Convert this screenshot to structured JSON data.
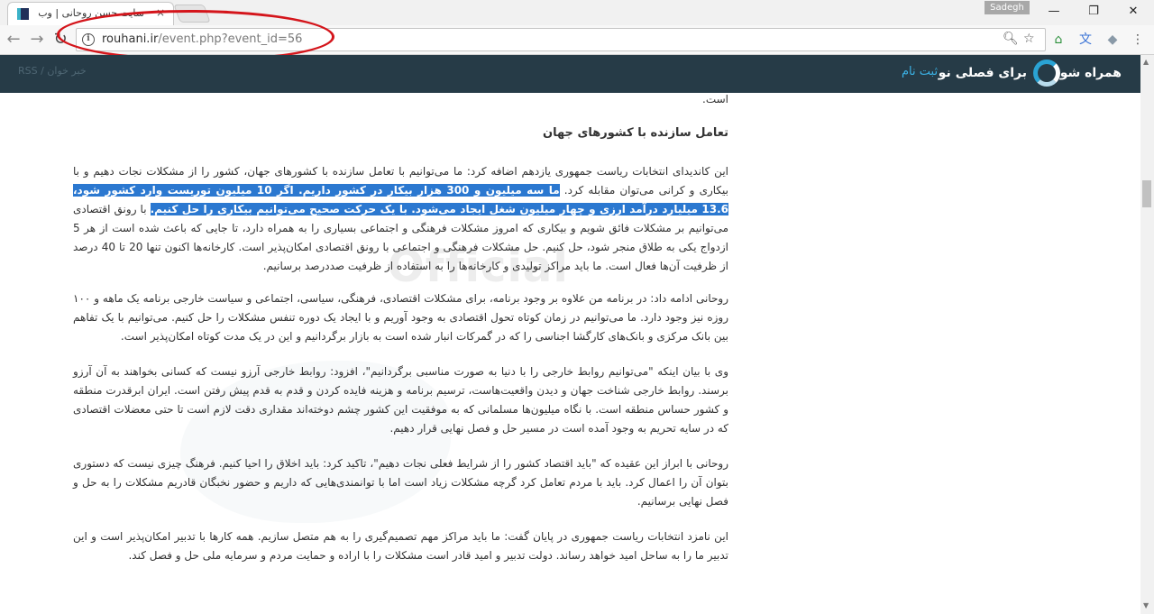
{
  "browser": {
    "tab_title": "سایت حسن روحانی | وب",
    "tab_close": "×",
    "user_label": "Sadegh",
    "window_buttons": [
      "—",
      "❐",
      "✕"
    ],
    "url_host": "rouhani.ir",
    "url_path": "/event.php?event_id=56",
    "icons": [
      "back-icon",
      "forward-icon",
      "reload-icon",
      "info-icon",
      "zoom-icon",
      "bookmark-star-icon",
      "home-extension-icon",
      "translate-extension-icon",
      "dropbox-extension-icon",
      "menu-icon"
    ]
  },
  "site_header": {
    "logo_text_1": "همراه شو",
    "logo_text_2": "برای فصلی نو",
    "register_label": "ثبت نام",
    "rss_label": "RSS / خبر خوان"
  },
  "watermark": "Official",
  "annotation_color": "#d4151b",
  "article": {
    "tail_text": "است.",
    "heading": "تعامل سازنده با کشورهای جهان",
    "p1_before": "این کاندیدای انتخابات ریاست جمهوری یازدهم اضافه کرد: ما می‌توانیم با تعامل سازنده با کشورهای جهان، کشور را از مشکلات نجات دهیم و با بیکاری و کرانی می‌توان مقابله کرد. ",
    "p1_highlight": "ما سه میلیون و 300 هزار بیکار در کشور داریم. اگر 10 میلیون توریست وارد کشور شود، 13.6 میلیارد درآمد ارزی و چهار میلیون شغل ایجاد می‌شود. با یک حرکت صحیح می‌توانیم بیکاری را حل کنیم.",
    "p1_after": " با رونق اقتصادی می‌توانیم بر مشکلات فائق شویم و بیکاری که امروز مشکلات فرهنگی و اجتماعی بسیاری را به همراه دارد، تا جایی که باعث شده است از هر 5 ازدواج یکی به طلاق منجر شود، حل کنیم. حل مشکلات فرهنگی و اجتماعی با رونق اقتصادی امکان‌پذیر است. کارخانه‌ها اکنون تنها 20 تا 40 درصد از ظرفیت آن‌ها فعال است. ما باید مراکز تولیدی و کارخانه‌ها را به استفاده از ظرفیت صددرصد برسانیم.",
    "p2": "روحانی ادامه داد: در برنامه من علاوه بر وجود برنامه، برای مشکلات اقتصادی، فرهنگی، سیاسی، اجتماعی و سیاست خارجی برنامه یک ماهه و ۱۰۰ روزه نیز وجود دارد. ما می‌توانیم در زمان کوتاه تحول اقتصادی به وجود آوریم و با ایجاد یک دوره تنفس مشکلات را حل کنیم. می‌توانیم با یک تفاهم بین بانک مرکزی و بانک‌های کارگشا اجناسی را که در گمرکات انبار شده است به بازار برگردانیم و این در یک مدت کوتاه امکان‌پذیر است.",
    "p3": "وی با بیان اینکه \"می‌توانیم روابط خارجی را با دنیا به صورت مناسبی برگردانیم\"، افزود: روابط خارجی آرزو نیست که کسانی بخواهند به آن آرزو برسند. روابط خارجی شناخت جهان و دیدن واقعیت‌هاست، ترسیم برنامه و هزینه فایده کردن و قدم به قدم پیش رفتن است. ایران ابرقدرت منطقه و کشور حساس منطقه است. با نگاه میلیون‌ها مسلمانی که به موفقیت این کشور چشم دوخته‌اند مقداری دقت لازم است تا حتی معضلات اقتصادی که در سایه تحریم به وجود آمده است در مسیر حل و فصل نهایی قرار دهیم.",
    "p4": "روحانی با ابراز این عقیده که \"باید اقتصاد کشور را از شرایط فعلی نجات دهیم\"، تاکید کرد: باید اخلاق را احیا کنیم. فرهنگ چیزی نیست که دستوری بتوان آن را اعمال کرد. باید با مردم تعامل کرد گرچه مشکلات زیاد است اما با توانمندی‌هایی که داریم و حضور نخبگان قادریم مشکلات را به حل و فصل نهایی برسانیم.",
    "p5": "این نامزد انتخابات ریاست جمهوری در پایان گفت: ما باید مراکز مهم تصمیم‌گیری را به هم متصل سازیم. همه کارها با تدبیر امکان‌پذیر است و این تدبیر ما را به ساحل امید خواهد رساند. دولت تدبیر و امید قادر است مشکلات را با اراده و حمایت مردم و سرمایه ملی حل و فصل کند."
  }
}
